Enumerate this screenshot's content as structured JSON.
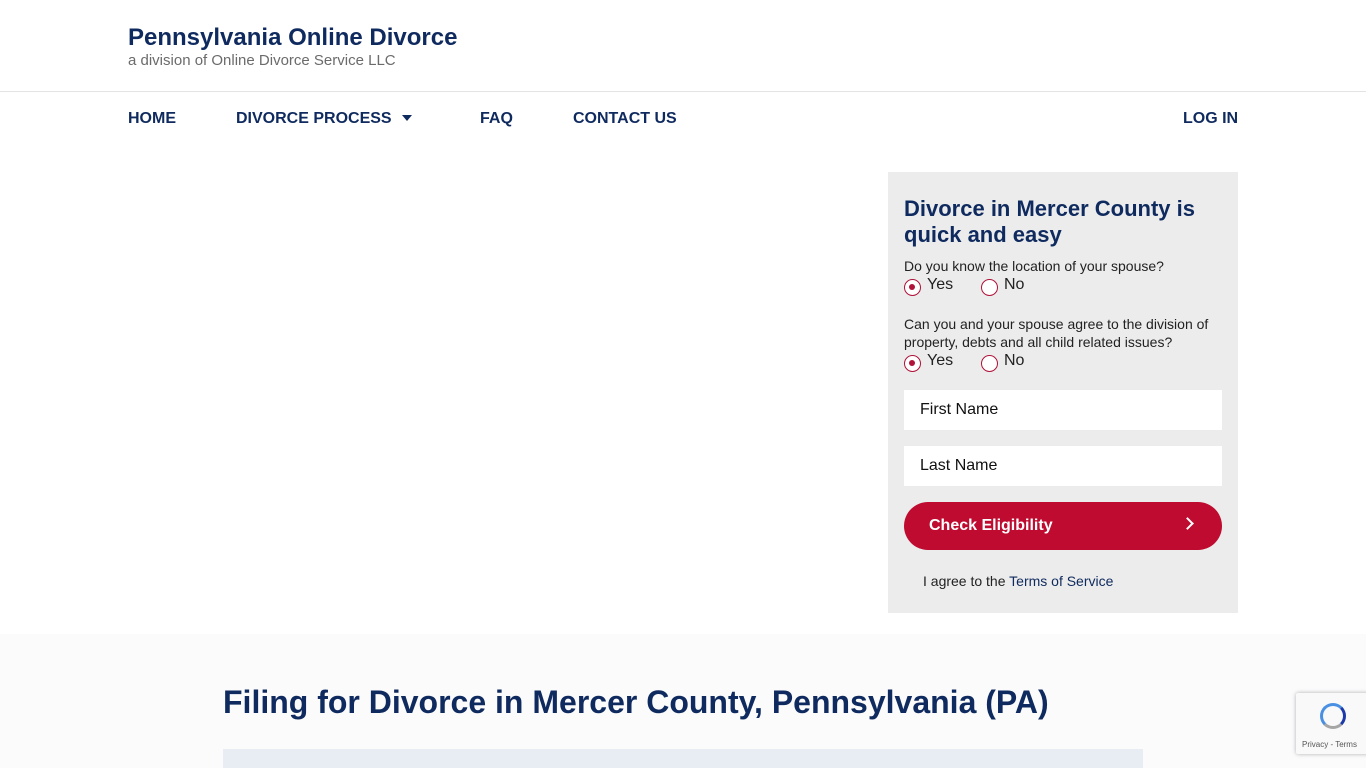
{
  "header": {
    "brand_title": "Pennsylvania Online Divorce",
    "brand_subtitle": "a division of Online Divorce Service LLC"
  },
  "nav": {
    "items": [
      {
        "label": "HOME"
      },
      {
        "label": "DIVORCE PROCESS",
        "has_dropdown": true
      },
      {
        "label": "FAQ"
      },
      {
        "label": "CONTACT US"
      }
    ],
    "login_label": "LOG IN"
  },
  "form": {
    "title": "Divorce in Mercer County is quick and easy",
    "question1": {
      "text": "Do you know the location of your spouse?",
      "options": [
        "Yes",
        "No"
      ],
      "selected": "Yes"
    },
    "question2": {
      "text": "Can you and your spouse agree to the division of property, debts and all child related issues?",
      "options": [
        "Yes",
        "No"
      ],
      "selected": "Yes"
    },
    "first_name_placeholder": "First Name",
    "last_name_placeholder": "Last Name",
    "submit_label": "Check Eligibility",
    "agree_prefix": "I agree to the",
    "terms_link": "Terms of Service"
  },
  "section": {
    "title": "Filing for Divorce in Mercer County, Pennsylvania (PA)"
  },
  "recaptcha": {
    "links": "Privacy - Terms"
  },
  "colors": {
    "brand_navy": "#0f2a5e",
    "accent_red": "#be0b2f",
    "panel_gray": "#ececec"
  }
}
